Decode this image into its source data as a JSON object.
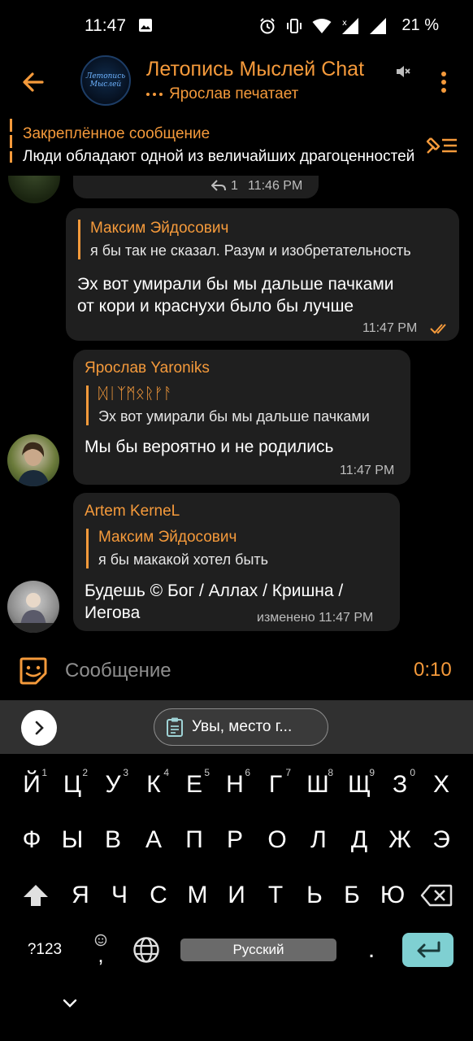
{
  "status_bar": {
    "time": "11:47",
    "battery": "21 %",
    "icons": [
      "image-icon",
      "alarm-icon",
      "vibrate-icon",
      "wifi-icon",
      "signal-x-icon",
      "signal-icon"
    ]
  },
  "header": {
    "title": "Летопись Мыслей Chat",
    "avatar_text_line1": "Летопись",
    "avatar_text_line2": "Мыслей",
    "typing": "Ярослав печатает",
    "muted": true
  },
  "pinned": {
    "title": "Закреплённое сообщение",
    "text": "Люди обладают одной из величайших драгоценностей"
  },
  "messages": [
    {
      "id": "m0",
      "replies_count": "1",
      "time": "11:46 PM"
    },
    {
      "id": "m1",
      "outgoing": true,
      "reply_to_name": "Максим Эйдосович",
      "reply_to_text": "я бы так не сказал. Разум и изобретательность",
      "text_line1": "Эх вот умирали бы мы дальше пачками",
      "text_line2": "от кори и краснухи было бы лучше",
      "time": "11:47 PM"
    },
    {
      "id": "m2",
      "sender": "Ярослав Yaroniks",
      "reply_to_name": "ᛞᛁᛉᛗᛟᚱᚠᚨ",
      "reply_to_text": "Эх вот умирали бы мы дальше пачками",
      "text": "Мы бы вероятно и не родились",
      "time": "11:47 PM"
    },
    {
      "id": "m3",
      "sender": "Artem KerneL",
      "reply_to_name": "Максим Эйдосович",
      "reply_to_text": "я бы макакой хотел быть",
      "text_line1": "Будешь © Бог / Аллах / Кришна /",
      "text_line2": "Иегова",
      "time": "изменено 11:47 PM"
    }
  ],
  "input": {
    "placeholder": "Сообщение",
    "recording_time": "0:10"
  },
  "keyboard": {
    "clipboard_chip": "Увы, место г...",
    "row1": [
      {
        "k": "Й",
        "n": "1"
      },
      {
        "k": "Ц",
        "n": "2"
      },
      {
        "k": "У",
        "n": "3"
      },
      {
        "k": "К",
        "n": "4"
      },
      {
        "k": "Е",
        "n": "5"
      },
      {
        "k": "Н",
        "n": "6"
      },
      {
        "k": "Г",
        "n": "7"
      },
      {
        "k": "Ш",
        "n": "8"
      },
      {
        "k": "Щ",
        "n": "9"
      },
      {
        "k": "З",
        "n": "0"
      },
      {
        "k": "Х",
        "n": ""
      }
    ],
    "row2": [
      "Ф",
      "Ы",
      "В",
      "А",
      "П",
      "Р",
      "О",
      "Л",
      "Д",
      "Ж",
      "Э"
    ],
    "row3": [
      "Я",
      "Ч",
      "С",
      "М",
      "И",
      "Т",
      "Ь",
      "Б",
      "Ю"
    ],
    "symbols_key": "?123",
    "comma_key": ",",
    "space_label": "Русский",
    "period_key": "."
  },
  "colors": {
    "accent": "#f59a3b",
    "bubble": "#1f1f1f",
    "enter_key": "#7fd0d2"
  }
}
